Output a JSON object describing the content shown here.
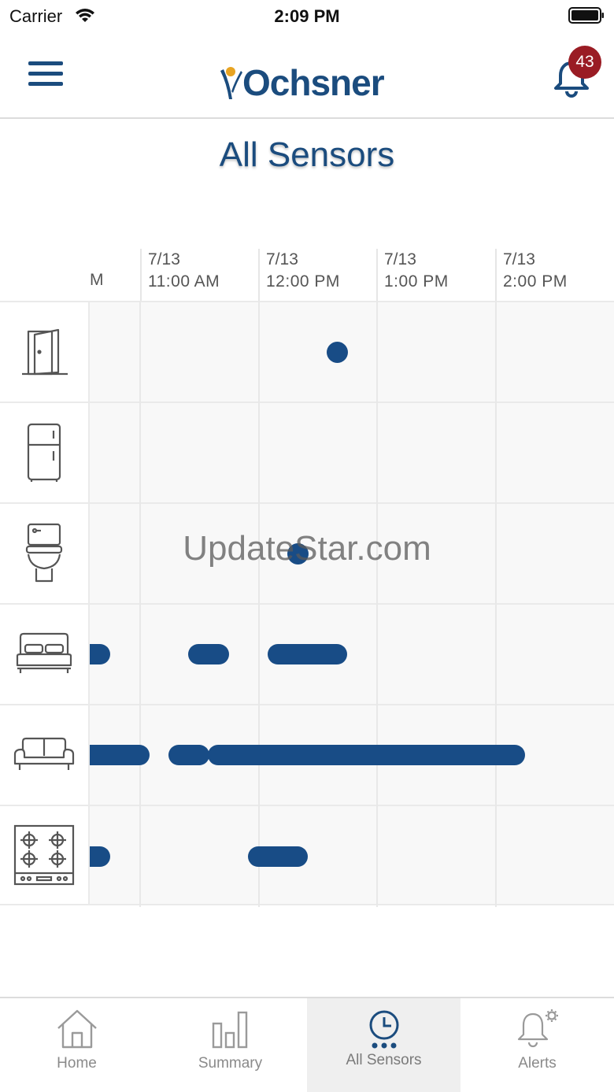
{
  "status_bar": {
    "carrier": "Carrier",
    "time": "2:09 PM"
  },
  "header": {
    "logo_text": "Ochsner",
    "notification_count": "43"
  },
  "page": {
    "title": "All Sensors"
  },
  "timeline": {
    "partial_label": "M",
    "columns": [
      {
        "date": "7/13",
        "time": "11:00 AM"
      },
      {
        "date": "7/13",
        "time": "12:00 PM"
      },
      {
        "date": "7/13",
        "time": "1:00 PM"
      },
      {
        "date": "7/13",
        "time": "2:00 PM"
      }
    ],
    "sensors": [
      {
        "name": "door",
        "icon": "door-icon"
      },
      {
        "name": "refrigerator",
        "icon": "fridge-icon"
      },
      {
        "name": "toilet",
        "icon": "toilet-icon"
      },
      {
        "name": "bed",
        "icon": "bed-icon"
      },
      {
        "name": "sofa",
        "icon": "sofa-icon"
      },
      {
        "name": "stove",
        "icon": "stove-icon"
      }
    ]
  },
  "watermark": "UpdateStar.com",
  "tab_bar": {
    "tabs": [
      {
        "label": "Home",
        "icon": "home-icon"
      },
      {
        "label": "Summary",
        "icon": "bar-chart-icon"
      },
      {
        "label": "All Sensors",
        "icon": "clock-icon"
      },
      {
        "label": "Alerts",
        "icon": "bell-gear-icon"
      }
    ],
    "active": "All Sensors"
  },
  "colors": {
    "brand": "#1b4c7e",
    "activity": "#184c86",
    "badge": "#9a1c24"
  }
}
